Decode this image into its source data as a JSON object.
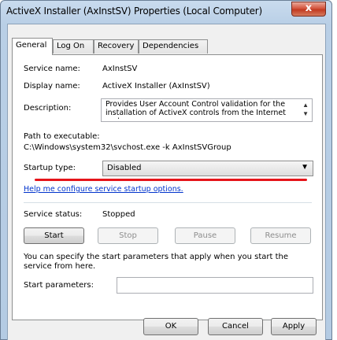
{
  "window": {
    "title": "ActiveX Installer (AxInstSV) Properties (Local Computer)",
    "close_label": "x"
  },
  "tabs": [
    {
      "label": "General",
      "active": true
    },
    {
      "label": "Log On",
      "active": false
    },
    {
      "label": "Recovery",
      "active": false
    },
    {
      "label": "Dependencies",
      "active": false
    }
  ],
  "general": {
    "service_name_label": "Service name:",
    "service_name": "AxInstSV",
    "display_name_label": "Display name:",
    "display_name": "ActiveX Installer (AxInstSV)",
    "description_label": "Description:",
    "description": "Provides User Account Control validation for the installation of ActiveX controls from the Internet and",
    "path_label": "Path to executable:",
    "path": "C:\\Windows\\system32\\svchost.exe -k AxInstSVGroup",
    "startup_type_label": "Startup type:",
    "startup_type": "Disabled",
    "help_link": "Help me configure service startup options.",
    "service_status_label": "Service status:",
    "service_status": "Stopped",
    "start_label": "Start",
    "stop_label": "Stop",
    "pause_label": "Pause",
    "resume_label": "Resume",
    "start_params_info": "You can specify the start parameters that apply when you start the service from here.",
    "start_params_label": "Start parameters:",
    "start_params_value": ""
  },
  "footer": {
    "ok_label": "OK",
    "cancel_label": "Cancel",
    "apply_label": "Apply"
  },
  "colors": {
    "annotation_line": "#e5141a",
    "link": "#0033cc",
    "close_button": "#c23a21"
  }
}
